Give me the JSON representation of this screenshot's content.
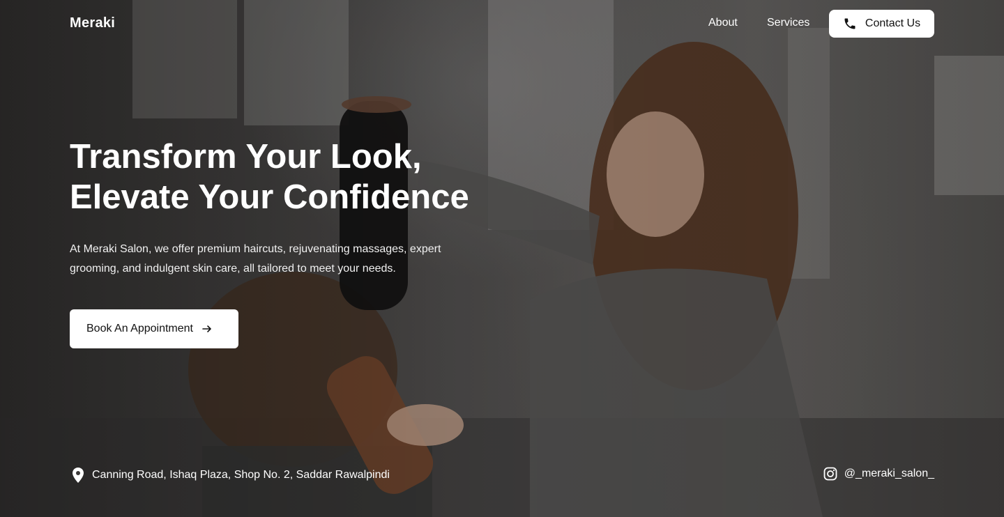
{
  "nav": {
    "brand": "Meraki",
    "links": [
      {
        "label": "About"
      },
      {
        "label": "Services"
      }
    ],
    "contact_label": "Contact Us"
  },
  "hero": {
    "headline_line1": "Transform Your Look,",
    "headline_line2": "Elevate Your Confidence",
    "description": "At Meraki Salon, we offer premium haircuts, rejuvenating massages, expert grooming, and indulgent skin care, all tailored to meet your needs.",
    "cta_label": "Book An Appointment"
  },
  "footer": {
    "address": "Canning Road, Ishaq Plaza, Shop No. 2, Saddar Rawalpindi",
    "instagram_handle": "@_meraki_salon_"
  },
  "icons": {
    "contact": "phone-icon",
    "cta": "arrow-right-icon",
    "address": "location-pin-icon",
    "instagram": "instagram-icon"
  },
  "colors": {
    "button_background": "#ffffff",
    "button_text": "#111111",
    "hero_text": "#ffffff"
  }
}
